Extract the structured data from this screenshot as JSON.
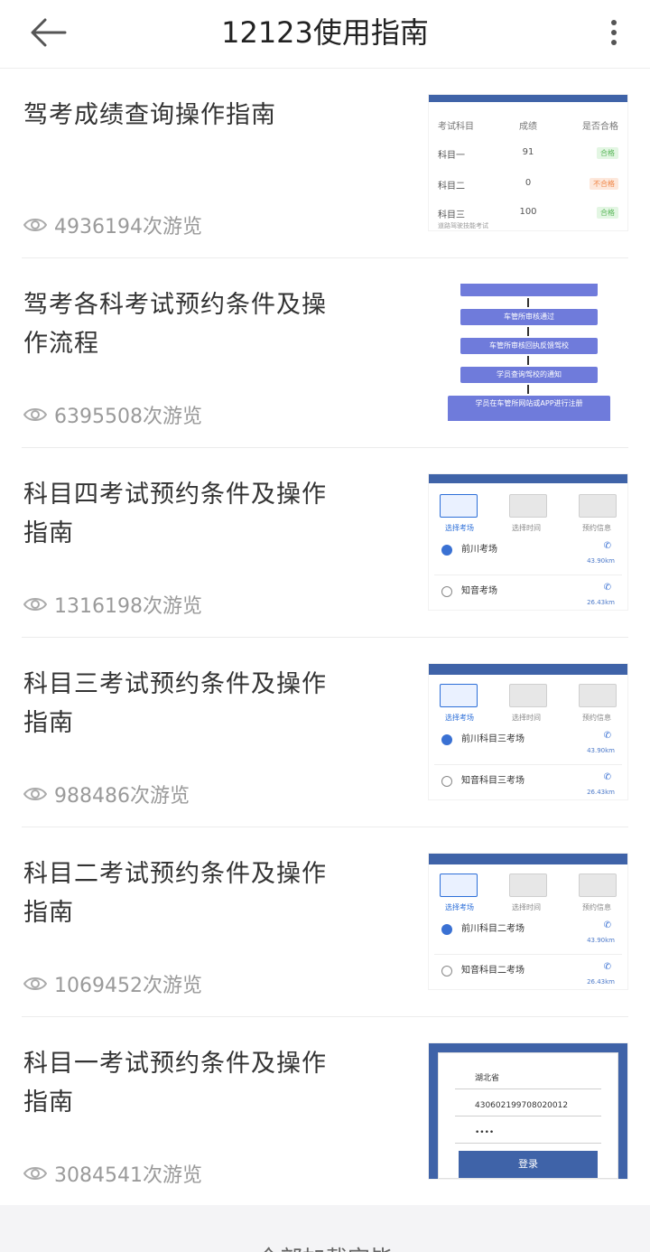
{
  "header": {
    "title": "12123使用指南",
    "back_icon": "arrow-left-icon",
    "more_icon": "more-vertical-icon"
  },
  "items": [
    {
      "title": "驾考成绩查询操作指南",
      "views": "4936194次游览"
    },
    {
      "title": "驾考各科考试预约条件及操作流程",
      "views": "6395508次游览"
    },
    {
      "title": "科目四考试预约条件及操作指南",
      "views": "1316198次游览"
    },
    {
      "title": "科目三考试预约条件及操作指南",
      "views": "988486次游览"
    },
    {
      "title": "科目二考试预约条件及操作指南",
      "views": "1069452次游览"
    },
    {
      "title": "科目一考试预约条件及操作指南",
      "views": "3084541次游览"
    }
  ],
  "thumb_scores": {
    "head": [
      "考试科目",
      "成绩",
      "是否合格"
    ],
    "rows": [
      [
        "科目一",
        "91",
        "合格"
      ],
      [
        "科目二",
        "0",
        "不合格"
      ],
      [
        "科目三",
        "100",
        "合格"
      ]
    ],
    "note": "道路驾驶技能考试"
  },
  "thumb_flow": {
    "steps": [
      "车管所审核通过",
      "车管所审核回执反馈驾校",
      "学员查询驾校的通知",
      "学员在车管所网站或APP进行注册"
    ]
  },
  "thumb_booking": {
    "steps": [
      "选择考场",
      "选择时间",
      "预约信息"
    ],
    "k4": [
      {
        "name": "前川考场",
        "distance": "43.90km"
      },
      {
        "name": "知音考场",
        "distance": "26.43km"
      }
    ],
    "k3": [
      {
        "name": "前川科目三考场",
        "distance": "43.90km"
      },
      {
        "name": "知音科目三考场",
        "distance": "26.43km"
      }
    ],
    "k2": [
      {
        "name": "前川科目二考场",
        "distance": "43.90km"
      },
      {
        "name": "知音科目二考场",
        "distance": "26.43km"
      }
    ]
  },
  "thumb_login": {
    "province": "湖北省",
    "id_number": "430602199708020012",
    "password_mask": "••••",
    "button": "登录"
  },
  "footer": {
    "text": "全部加载完毕"
  },
  "colors": {
    "accent": "#3f63a8",
    "pass": "#5cb85c",
    "fail": "#f0884a"
  }
}
